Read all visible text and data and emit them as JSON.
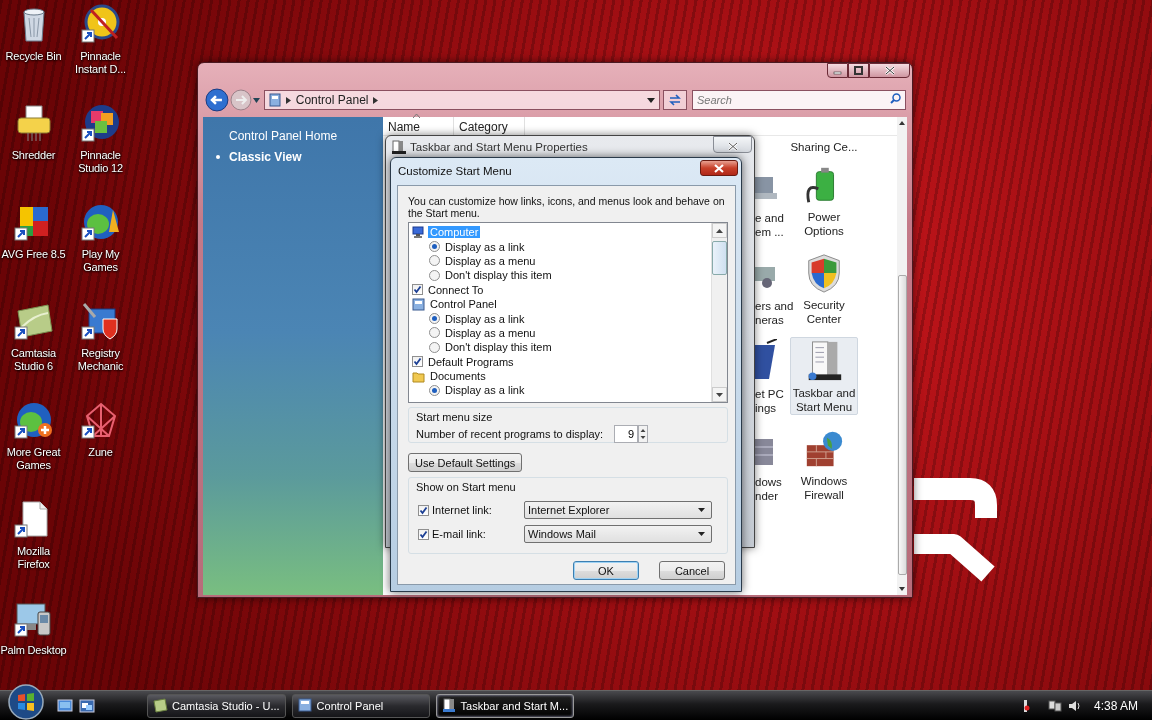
{
  "desktop_icons": [
    [
      {
        "label": "Recycle Bin",
        "shortcut": false
      },
      {
        "label": "Pinnacle Instant D...",
        "shortcut": true
      }
    ],
    [
      {
        "label": "Shredder",
        "shortcut": false
      },
      {
        "label": "Pinnacle Studio 12",
        "shortcut": true
      }
    ],
    [
      {
        "label": "AVG Free 8.5",
        "shortcut": true
      },
      {
        "label": "Play My Games",
        "shortcut": true
      }
    ],
    [
      {
        "label": "Camtasia Studio 6",
        "shortcut": true
      },
      {
        "label": "Registry Mechanic",
        "shortcut": true
      }
    ],
    [
      {
        "label": "More Great Games",
        "shortcut": true
      },
      {
        "label": "Zune",
        "shortcut": true
      }
    ],
    [
      {
        "label": "Mozilla Firefox",
        "shortcut": true
      }
    ],
    [
      {
        "label": "Palm Desktop",
        "shortcut": true
      }
    ]
  ],
  "control_panel": {
    "breadcrumb": [
      "Control Panel"
    ],
    "search_placeholder": "Search",
    "nav": [
      {
        "label": "Control Panel Home",
        "selected": false
      },
      {
        "label": "Classic View",
        "selected": true
      }
    ],
    "columns": [
      {
        "label": "Name",
        "sorted": true
      },
      {
        "label": "Category",
        "sorted": false
      }
    ],
    "items": [
      {
        "kind": "text",
        "lines": [
          "Sharing Ce..."
        ],
        "selected": false
      },
      {
        "kind": "icon",
        "lines": [
          "Power",
          "Options"
        ],
        "selected": false
      },
      {
        "kind": "icon",
        "lines": [
          "Security",
          "Center"
        ],
        "selected": false
      },
      {
        "kind": "icon",
        "lines": [
          "Taskbar and",
          "Start Menu"
        ],
        "selected": true
      },
      {
        "kind": "icon",
        "lines": [
          "Windows",
          "Firewall"
        ],
        "selected": false
      }
    ],
    "partial_items": [
      {
        "lines": [
          "e and",
          "em ..."
        ]
      },
      {
        "lines": [
          "ers and",
          "neras"
        ]
      },
      {
        "lines": [
          "et PC",
          "ings"
        ]
      },
      {
        "lines": [
          "dows",
          "nder"
        ]
      }
    ]
  },
  "taskbar_properties": {
    "title": "Taskbar and Start Menu Properties"
  },
  "customize": {
    "title": "Customize Start Menu",
    "description": "You can customize how links, icons, and menus look and behave on the Start menu.",
    "tree": [
      {
        "kind": "icon",
        "label": "Computer",
        "selected": true,
        "options": [
          {
            "label": "Display as a link",
            "selected": true
          },
          {
            "label": "Display as a menu",
            "selected": false
          },
          {
            "label": "Don't display this item",
            "selected": false
          }
        ]
      },
      {
        "kind": "checkbox",
        "label": "Connect To",
        "selected": false,
        "checked": true
      },
      {
        "kind": "icon",
        "label": "Control Panel",
        "selected": false,
        "options": [
          {
            "label": "Display as a link",
            "selected": true
          },
          {
            "label": "Display as a menu",
            "selected": false
          },
          {
            "label": "Don't display this item",
            "selected": false
          }
        ]
      },
      {
        "kind": "checkbox",
        "label": "Default Programs",
        "selected": false,
        "checked": true
      },
      {
        "kind": "icon",
        "label": "Documents",
        "selected": false,
        "options": [
          {
            "label": "Display as a link",
            "selected": true
          }
        ]
      }
    ],
    "size_group": {
      "title": "Start menu size",
      "label": "Number of recent programs to display:",
      "value": "9"
    },
    "reset_button": "Use Default Settings",
    "show_group": {
      "title": "Show on Start menu",
      "rows": [
        {
          "label": "Internet link:",
          "checked": true,
          "value": "Internet Explorer"
        },
        {
          "label": "E-mail link:",
          "checked": true,
          "value": "Windows Mail"
        }
      ]
    },
    "buttons": [
      {
        "label": "OK",
        "default": true
      },
      {
        "label": "Cancel",
        "default": false
      }
    ]
  },
  "taskbar": {
    "tasks": [
      {
        "label": "Camtasia Studio - U...",
        "selected": false
      },
      {
        "label": "Control Panel",
        "selected": false
      },
      {
        "label": "Taskbar and Start M...",
        "selected": true
      }
    ],
    "clock": "4:38 AM"
  }
}
